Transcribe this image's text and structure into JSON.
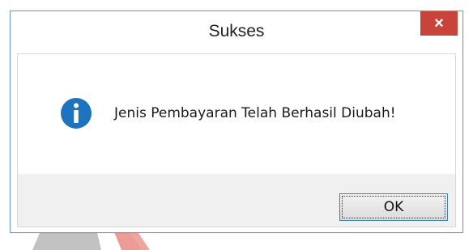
{
  "dialog": {
    "title": "Sukses",
    "close_glyph": "×",
    "message": "Jenis Pembayaran Telah Berhasil Diubah!",
    "icon": "info-icon",
    "ok_label": "OK"
  },
  "colors": {
    "close_button": "#c8443a",
    "info_icon": "#1e73be",
    "window_border": "#6f9bd1",
    "button_area": "#f0f0f0",
    "watermark_red": "#d6453e",
    "watermark_gray": "#9a9a9a"
  }
}
